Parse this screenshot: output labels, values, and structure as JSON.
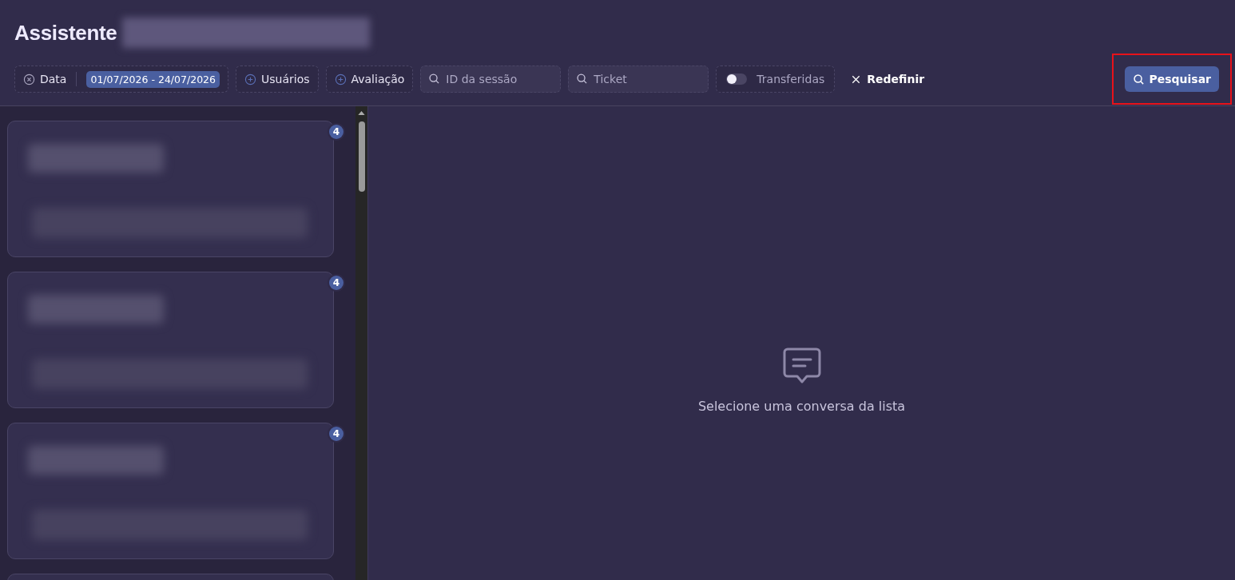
{
  "header": {
    "title": "Assistente",
    "title_redacted": true
  },
  "filters": [
    {
      "kind": "date",
      "label": "Data",
      "value": "01/07/2026 - 24/07/2026"
    },
    {
      "kind": "add",
      "label": "Usuários"
    },
    {
      "kind": "add",
      "label": "Avaliação"
    },
    {
      "kind": "search",
      "placeholder": "ID da sessão"
    },
    {
      "kind": "search",
      "placeholder": "Ticket"
    },
    {
      "kind": "toggle",
      "label": "Transferidas",
      "on": false
    },
    {
      "kind": "reset",
      "label": "Redefinir"
    }
  ],
  "search_button": {
    "label": "Pesquisar",
    "highlighted": true
  },
  "conversations": [
    {
      "kind": "conversation",
      "badge": "4",
      "redacted": true
    },
    {
      "kind": "conversation",
      "badge": "4",
      "redacted": true
    },
    {
      "kind": "conversation",
      "badge": "4",
      "redacted": true
    },
    {
      "kind": "conversation"
    }
  ],
  "empty_state": {
    "message": "Selecione uma conversa da lista"
  }
}
